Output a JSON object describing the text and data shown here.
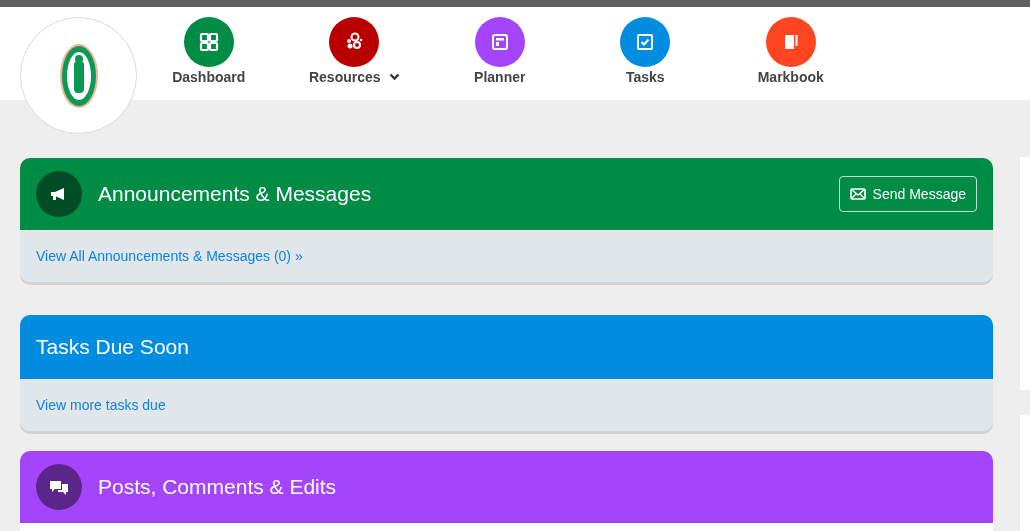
{
  "nav": [
    {
      "label": "Dashboard",
      "color": "#008c44",
      "has_menu": false
    },
    {
      "label": "Resources",
      "color": "#b80000",
      "has_menu": true
    },
    {
      "label": "Planner",
      "color": "#a445fb",
      "has_menu": false
    },
    {
      "label": "Tasks",
      "color": "#008de0",
      "has_menu": false
    },
    {
      "label": "Markbook",
      "color": "#ff4522",
      "has_menu": false
    }
  ],
  "cards": [
    {
      "title": "Announcements & Messages",
      "color": "#008c44",
      "button": "Send Message",
      "link": "View All Announcements & Messages (0) »"
    },
    {
      "title": "Tasks Due Soon",
      "color": "#008de0",
      "link": "View more tasks due"
    },
    {
      "title": "Posts, Comments & Edits",
      "color": "#a445fb"
    }
  ]
}
